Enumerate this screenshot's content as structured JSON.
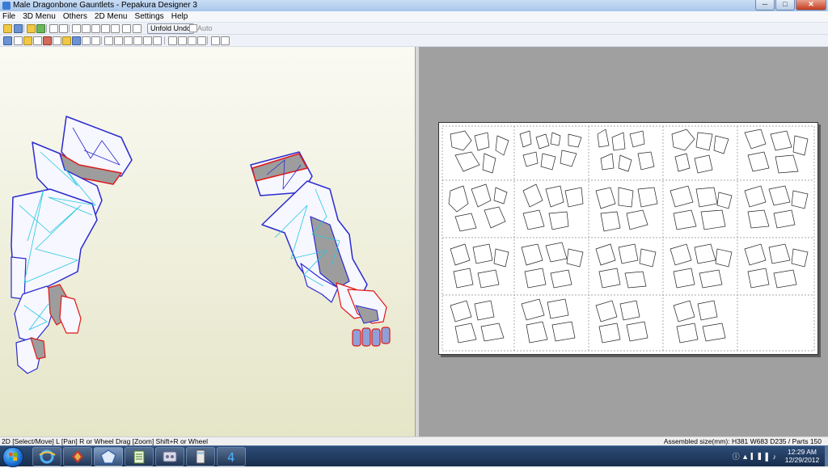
{
  "window": {
    "title": "Male Dragonbone Gauntlets - Pepakura Designer 3"
  },
  "menu": [
    "File",
    "3D Menu",
    "Others",
    "2D Menu",
    "Settings",
    "Help"
  ],
  "toolbar": {
    "unfold_undo_label": "Unfold Undo",
    "auto_label": "Auto",
    "auto_checked": false
  },
  "status": {
    "left": "2D [Select/Move] L [Pan] R or Wheel Drag [Zoom] Shift+R or Wheel",
    "right": "Assembled size(mm): H381 W683 D235 / Parts 150"
  },
  "clock": {
    "time": "12:29 AM",
    "date": "12/29/2012"
  },
  "taskbar": {
    "apps": [
      "ie-icon",
      "app-icon",
      "pepakura-icon",
      "notepad-icon",
      "media-icon",
      "calculator-icon",
      "app4-icon"
    ],
    "active": "pepakura-icon"
  },
  "colors": {
    "mesh_edge": "#2b2bd0",
    "cut_line": "#e01818",
    "fold_line": "#22c8e0",
    "face_shade": "#9d9d9d",
    "view2d_bg": "#a0a0a0"
  }
}
